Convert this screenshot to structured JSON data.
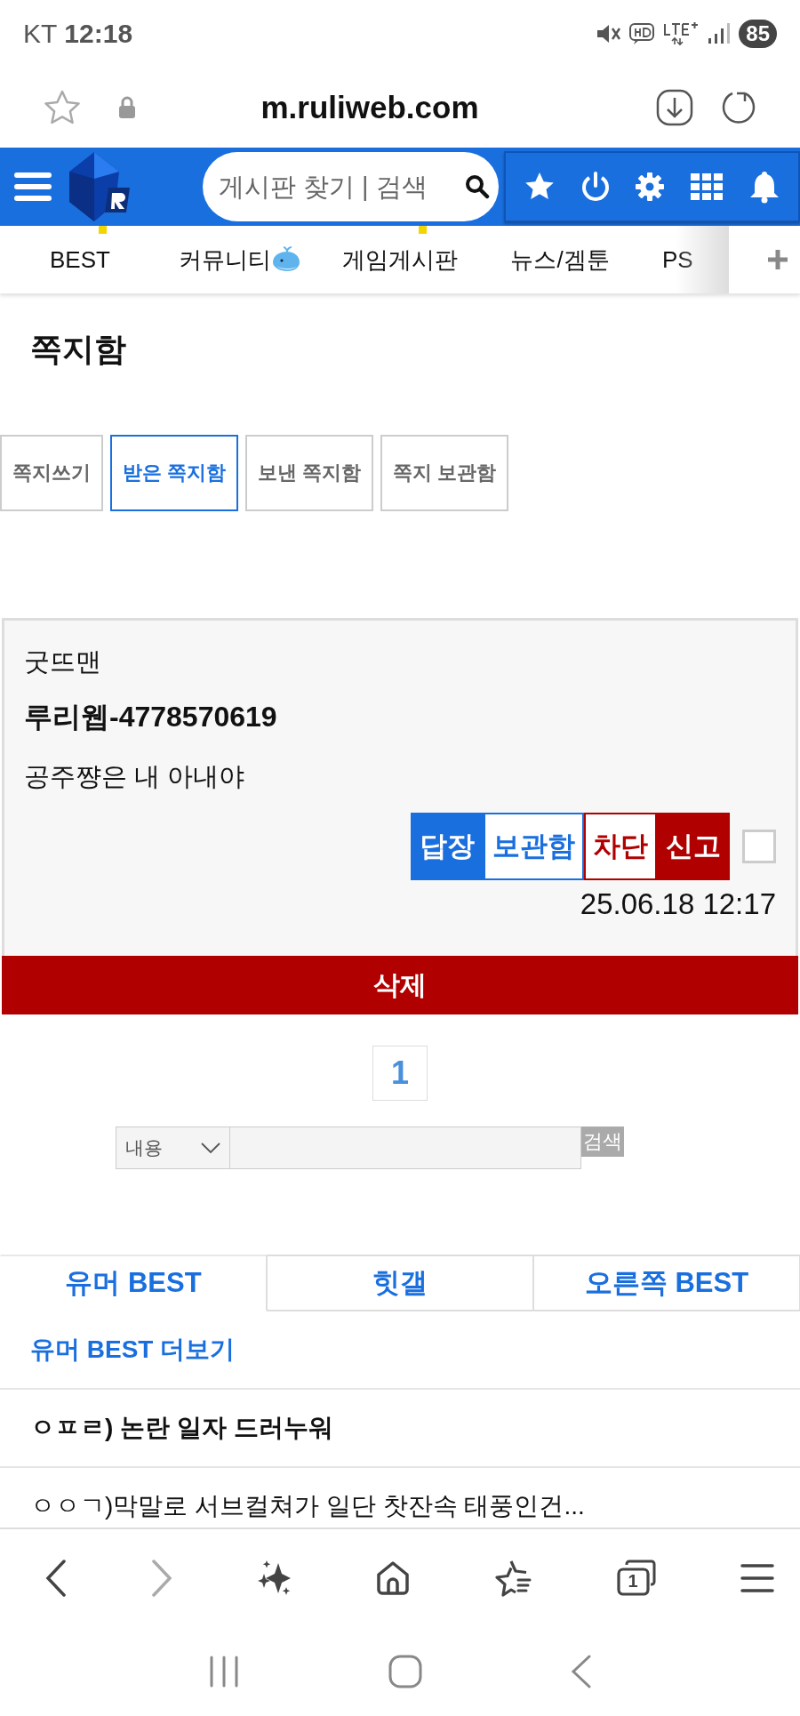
{
  "status_bar": {
    "carrier": "KT",
    "time": "12:18",
    "battery": "85"
  },
  "browser": {
    "url": "m.ruliweb.com"
  },
  "header": {
    "search_placeholder": "게시판 찾기 | 검색"
  },
  "nav_tabs": [
    {
      "label": "BEST",
      "marked": true
    },
    {
      "label": "커뮤니티",
      "whale": true,
      "marked": false
    },
    {
      "label": "게임게시판",
      "marked": true
    },
    {
      "label": "뉴스/겜툰",
      "marked": false
    },
    {
      "label": "PS",
      "marked": false
    }
  ],
  "page_title": "쪽지함",
  "mail_tabs": [
    {
      "label": "쪽지쓰기",
      "selected": false
    },
    {
      "label": "받은 쪽지함",
      "selected": true
    },
    {
      "label": "보낸 쪽지함",
      "selected": false
    },
    {
      "label": "쪽지 보관함",
      "selected": false
    }
  ],
  "message": {
    "sender": "굿뜨맨",
    "user_id": "루리웹-4778570619",
    "body": "공주쨩은 내 아내야",
    "actions": [
      {
        "label": "답장",
        "kind": "blue"
      },
      {
        "label": "보관함",
        "kind": "blue-outline"
      },
      {
        "label": "차단",
        "kind": "red-outline"
      },
      {
        "label": "신고",
        "kind": "red"
      }
    ],
    "checked": false,
    "date": "25.06.18 12:17"
  },
  "delete_button": "삭제",
  "pagination": [
    {
      "label": "1",
      "selected": true
    }
  ],
  "search": {
    "field": "내용",
    "button": "검색"
  },
  "best_tabs": [
    {
      "label": "유머 BEST",
      "selected": true
    },
    {
      "label": "힛갤",
      "selected": false
    },
    {
      "label": "오른쪽 BEST",
      "selected": false
    }
  ],
  "more_link": "유머 BEST 더보기",
  "posts": [
    {
      "title": "ㅇㅍㄹ) 논란 일자 드러누워",
      "bold": true
    },
    {
      "title": "ㅇㅇㄱ)막말로 서브컬쳐가 일단 찻잔속 태풍인건...",
      "bold": false
    }
  ],
  "bottom_nav": {
    "tab_count": "1"
  }
}
